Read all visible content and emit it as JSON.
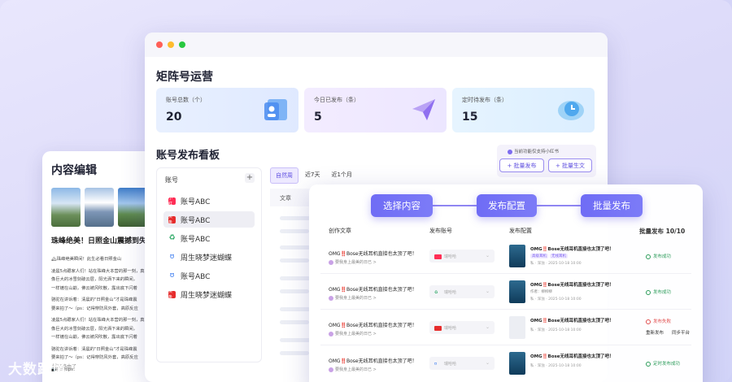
{
  "editor": {
    "title": "内容编辑",
    "headline": "珠峰绝美！日照金山震撼到失语",
    "lines": [
      "🏔珠峰绝美瞬间！此生必看日照金山",
      "凌晨5点跟家人们！站在珠峰大本营的那一刻，真",
      "像巨大的冰雪剑破云层，阳光洒下来的瞬间，",
      "一样镀在山巅，佛云被风吹散，露出底下闪着",
      "骆驼在讲诉着：清晨的\"日照金山\"才是珠峰震",
      "要来拍了～（ps：记得穿防风外套，高原反应",
      "凌晨5点跟家人们！站在珠峰大本营的那一刻，真",
      "像巨大的冰雪剑破云层，阳光洒下来的瞬间，",
      "一样镀在山巅，佛云被风吹散，露出底下闪着",
      "骆驼在讲诉着：清晨的\"日照金山\"才是珠峰震",
      "要来拍了～（ps：记得穿防风外套，高原反应",
      "📷拍照tips："
    ],
    "footer": "报文路由了"
  },
  "matrix": {
    "window_title": "矩阵号运营",
    "stats": [
      {
        "label": "账号总数（个）",
        "value": "20"
      },
      {
        "label": "今日已发布（条）",
        "value": "5"
      },
      {
        "label": "定时待发布（条）",
        "value": "15"
      }
    ],
    "board_title": "账号发布看板",
    "notice": "当前功能仅支持小红书",
    "batch_publish": "+ 批量发布",
    "batch_generate": "+ 批量生文",
    "account_header": "账号",
    "add": "+",
    "accounts": [
      {
        "name": "账号ABC",
        "icon": "red",
        "icon_text": "小红"
      },
      {
        "name": "账号ABC",
        "icon": "red2",
        "icon_text": "头条"
      },
      {
        "name": "账号ABC",
        "icon": "green",
        "icon_text": "♻"
      },
      {
        "name": "周生晓梦迷蝴蝶",
        "icon": "blue",
        "icon_text": "ʊ"
      },
      {
        "name": "账号ABC",
        "icon": "blue",
        "icon_text": "ʊ"
      },
      {
        "name": "周生晓梦迷蝴蝶",
        "icon": "red2",
        "icon_text": "头条"
      }
    ],
    "tabs": [
      "自然周",
      "近7天",
      "近1个月"
    ],
    "grid_header": "文章"
  },
  "publish": {
    "steps": [
      "选择内容",
      "发布配置",
      "批量发布"
    ],
    "headers": {
      "article": "创作文章",
      "account": "发布账号",
      "config": "发布配置",
      "status": "批量发布 10/10"
    },
    "rows": [
      {
        "title": "OMG‼️Bose无线耳机直接也太顶了吧！",
        "sub": "要我身上最美的日已 >",
        "account": "瑞哈哈",
        "cfg_title": "OMG‼️Bose无线耳机直接也太顶了吧！",
        "tags": [
          "高级耳机",
          "无线耳机"
        ],
        "meta": "私 · 浑浊 · 2025-10-18 10:00",
        "status": "发布成功",
        "status_type": "ok",
        "thumb": "photo"
      },
      {
        "title": "OMG‼️Bose无线耳机直接也太顶了吧！",
        "sub": "要我身上最美的日已 >",
        "account": "瑞哈哈",
        "cfg_title": "OMG‼️Bose无线耳机直接也太顶了吧！",
        "tags": [],
        "meta": "作者：柳柳柳",
        "meta2": "私 · 浑浊 · 2025-10-18 10:00",
        "status": "发布成功",
        "status_type": "ok",
        "thumb": "photo"
      },
      {
        "title": "OMG‼️Bose无线耳机直接也太顶了吧！",
        "sub": "要我身上最美的日已 >",
        "account": "瑞哈哈",
        "cfg_title": "OMG‼️Bose无线耳机直接也太顶了吧！",
        "tags": [],
        "meta": "私 · 浑浊 · 2025-10-18 10:00",
        "status": "发布失败",
        "status_type": "fail",
        "actions": [
          "重新发布",
          "同步平台"
        ],
        "thumb": "gray"
      },
      {
        "title": "OMG‼️Bose无线耳机直接也太顶了吧！",
        "sub": "要我身上最美的日已 >",
        "account": "瑞哈哈",
        "cfg_title": "OMG‼️Bose无线耳机直接也太顶了吧！",
        "tags": [],
        "meta": "私 · 浑浊 · 2025-10-18 10:00",
        "status": "定时发布成功",
        "status_type": "dark",
        "thumb": "photo"
      }
    ]
  },
  "watermark": "大数跨境",
  "colors": {
    "accent": "#6f6cf5",
    "success": "#2c9c5a",
    "fail": "#e14d4d"
  }
}
